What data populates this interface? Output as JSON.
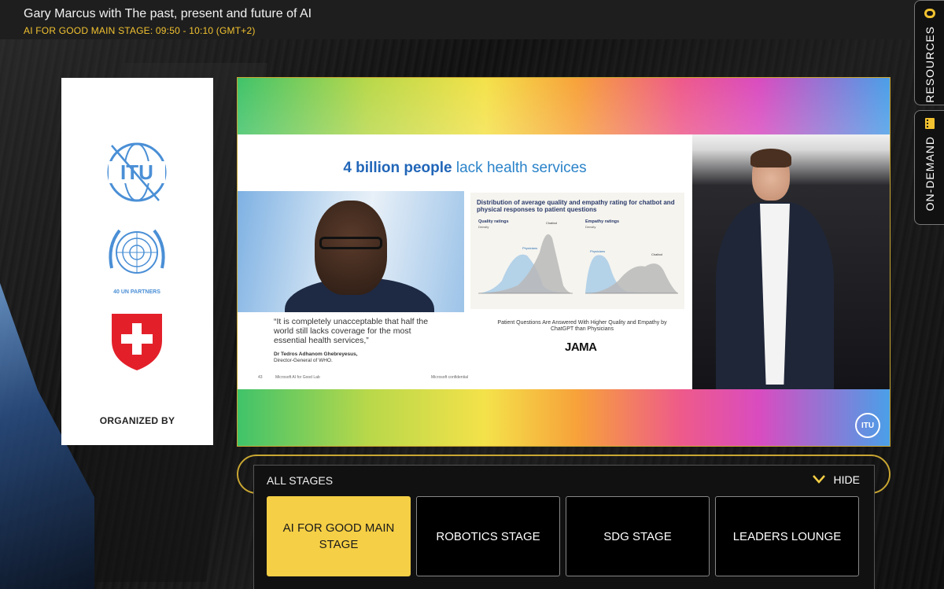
{
  "header": {
    "title": "Gary Marcus with The past, present and future of AI",
    "subtitle": "AI FOR GOOD MAIN STAGE: 09:50 - 10:10 (GMT+2)"
  },
  "side_tabs": {
    "resources": "RESOURCES",
    "on_demand": "ON-DEMAND"
  },
  "organizer": {
    "un_caption": "40 UN PARTNERS",
    "label": "ORGANIZED BY"
  },
  "slide": {
    "title_bold": "4 billion people",
    "title_light": "lack health services",
    "quote": "“It is completely unacceptable that half the world still lacks coverage for the most essential health services,”",
    "quote_author": "Dr Tedros Adhanom Ghebreyesus,",
    "quote_role": "Director-General of WHO.",
    "chart_title": "Distribution of average quality and empathy rating for chatbot and physical responses to patient questions",
    "chart_left_label": "Quality ratings",
    "chart_right_label": "Empathy ratings",
    "chart_density": "Density",
    "series_chatbot": "Chatbot",
    "series_physicians": "Physicians",
    "caption": "Patient Questions Are Answered With Higher Quality and Empathy by ChatGPT than Physicians",
    "journal": "JAMA",
    "footer_page": "43",
    "footer_lab": "Microsoft AI for Good Lab",
    "footer_conf": "Microsoft confidential"
  },
  "itu_badge": "ITU",
  "stages": {
    "header": "ALL STAGES",
    "hide_label": "HIDE",
    "items": [
      {
        "label": "AI FOR GOOD MAIN STAGE",
        "active": true
      },
      {
        "label": "ROBOTICS STAGE",
        "active": false
      },
      {
        "label": "SDG STAGE",
        "active": false
      },
      {
        "label": "LEADERS LOUNGE",
        "active": false
      }
    ]
  },
  "colors": {
    "accent": "#f5cf45",
    "gold_border": "#c9a632",
    "itu_blue": "#4a8fd6",
    "swiss_red": "#e3202a"
  }
}
